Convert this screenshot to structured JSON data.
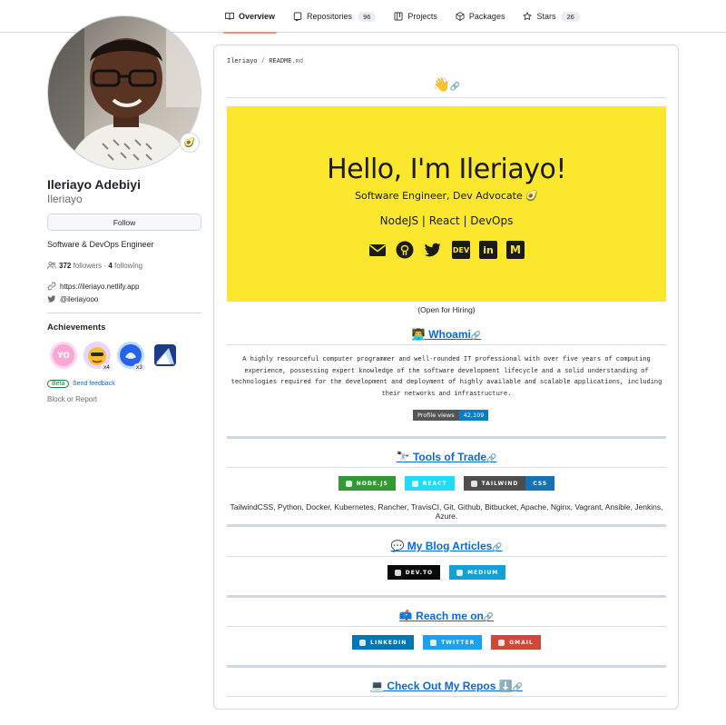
{
  "nav": {
    "tabs": [
      {
        "label": "Overview",
        "count": ""
      },
      {
        "label": "Repositories",
        "count": "96"
      },
      {
        "label": "Projects",
        "count": ""
      },
      {
        "label": "Packages",
        "count": ""
      },
      {
        "label": "Stars",
        "count": "26"
      }
    ]
  },
  "profile": {
    "status_emoji": "🥑",
    "full_name": "Ileriayo Adebiyi",
    "username": "Ileriayo",
    "follow_label": "Follow",
    "bio": "Software & DevOps Engineer",
    "followers_count": "372",
    "followers_label": "followers",
    "separator": "·",
    "following_count": "4",
    "following_label": "following",
    "website": "https://ileriayo.netlify.app",
    "twitter": "@ileriayooo",
    "achievements_title": "Achievements",
    "badges": [
      {
        "name": "yolo",
        "count": ""
      },
      {
        "name": "quickdraw",
        "count": "x4"
      },
      {
        "name": "pull-shark",
        "count": "x3"
      },
      {
        "name": "arctic-code-vault",
        "count": ""
      }
    ],
    "beta_label": "Beta",
    "feedback_label": "Send feedback",
    "block_label": "Block or Report"
  },
  "readme": {
    "path_user": "Ileriayo",
    "path_sep": " / ",
    "path_file": "README",
    "path_ext": ".md",
    "wave": "👋",
    "banner": {
      "title": "Hello, I'm Ileriayo!",
      "subtitle": "Software Engineer, Dev Advocate 🥑",
      "stack": "NodeJS | React | DevOps",
      "icons": [
        "mail-icon",
        "github-icon",
        "twitter-icon",
        "dev-icon",
        "linkedin-icon",
        "medium-icon"
      ],
      "dev_text": "DEV",
      "in_text": "in",
      "m_text": "M"
    },
    "hiring": "(Open for Hiring)",
    "whoami_heading": "👨‍💻 Whoami",
    "whoami_text": "A highly resourceful computer programmer and well-rounded IT professional with over five years of computing experience, possessing expert knowledge of the software development lifecycle and a solid understanding of technologies required for the development and deployment of highly available and scalable applications, including their networks and infrastructure.",
    "views_label": "Profile views",
    "views_count": "42,109",
    "tools_heading": "🔭 Tools of Trade",
    "tools_badges": [
      {
        "text": "NODE.JS",
        "color": "#339933"
      },
      {
        "text": "REACT",
        "color": "#20dbfb"
      },
      {
        "text": "TAILWIND",
        "color": "#4d4d4d"
      },
      {
        "text": "CSS",
        "color": "#1572b6"
      }
    ],
    "tools_text": "TailwindCSS, Python, Docker, Kubernetes, Rancher, TravisCI, Git, Github, Bitbucket, Apache, Nginx, Vagrant, Ansible, Jenkins, Azure.",
    "blog_heading": "💬 My Blog Articles",
    "blog_badges": [
      {
        "text": "DEV.TO",
        "color": "#0a0a0a"
      },
      {
        "text": "MEDIUM",
        "color": "#12a0d7"
      }
    ],
    "reach_heading": "📫 Reach me on",
    "reach_badges": [
      {
        "text": "LINKEDIN",
        "color": "#0077b5"
      },
      {
        "text": "TWITTER",
        "color": "#1ca0f2"
      },
      {
        "text": "GMAIL",
        "color": "#d14836"
      }
    ],
    "repos_heading": "💻 Check Out My Repos ⬇️",
    "anchor": "🔗"
  }
}
